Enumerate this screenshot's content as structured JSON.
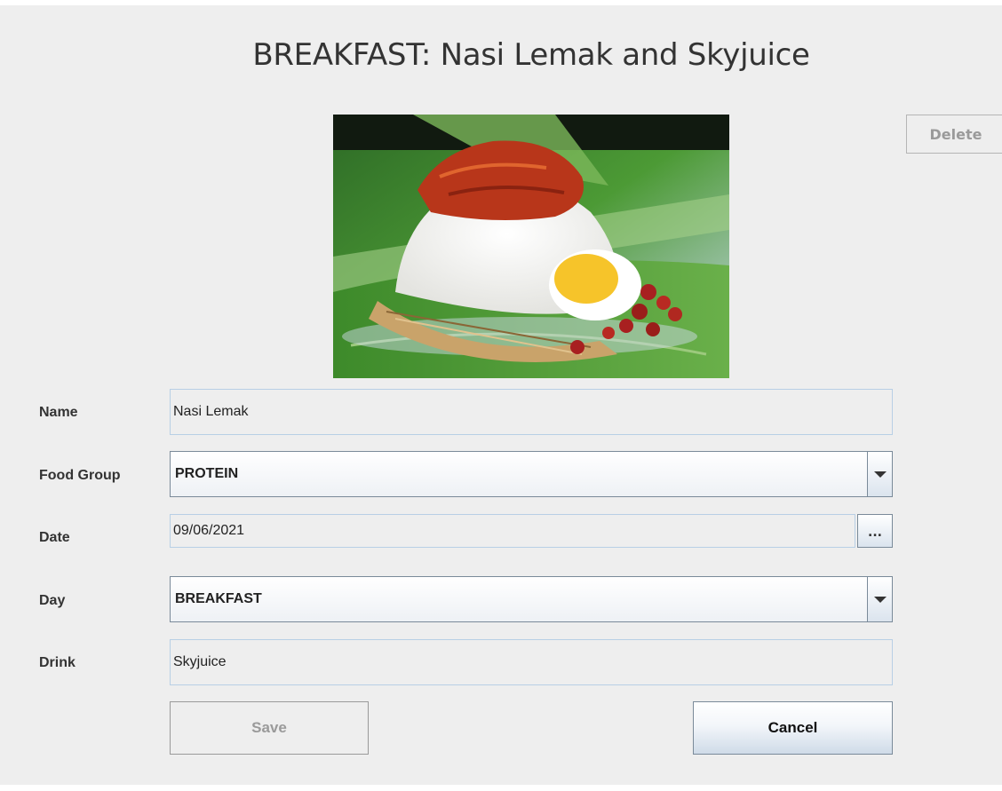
{
  "header": {
    "title": "BREAKFAST: Nasi Lemak and Skyjuice"
  },
  "toolbar": {
    "delete_label": "Delete"
  },
  "photo": {
    "subject": "nasi lemak with egg, anchovies, peanuts and sambal on banana leaf"
  },
  "form": {
    "name": {
      "label": "Name",
      "value": "Nasi Lemak"
    },
    "food_group": {
      "label": "Food Group",
      "value": "PROTEIN"
    },
    "date": {
      "label": "Date",
      "value": "09/06/2021",
      "picker_label": "..."
    },
    "day": {
      "label": "Day",
      "value": "BREAKFAST"
    },
    "drink": {
      "label": "Drink",
      "value": "Skyjuice"
    }
  },
  "actions": {
    "save_label": "Save",
    "cancel_label": "Cancel"
  },
  "colors": {
    "panel": "#eeeeee",
    "field_border": "#b8cfe5",
    "disabled_text": "#9a9a9a",
    "banana_leaf": "#3f8f2a",
    "sambal": "#b8361a",
    "egg_yolk": "#f6c42a"
  }
}
